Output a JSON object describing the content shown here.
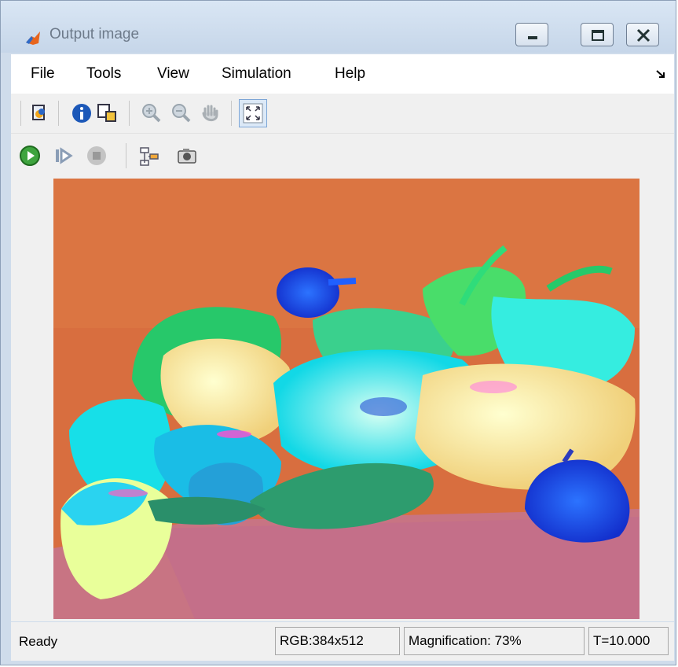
{
  "window": {
    "title": "Output image"
  },
  "menu": [
    "File",
    "Tools",
    "View",
    "Simulation",
    "Help"
  ],
  "toolbar": {
    "icons": [
      "print-icon",
      "info-icon",
      "export-icon",
      "zoom-in-icon",
      "zoom-out-icon",
      "pan-icon",
      "fit-to-window-icon"
    ],
    "sim_icons": [
      "run-icon",
      "step-forward-icon",
      "stop-icon",
      "highlight-block-icon",
      "snapshot-icon"
    ]
  },
  "image": {
    "description": "pseudo-color rendering of peppers"
  },
  "status": {
    "state": "Ready",
    "format": "RGB:384x512",
    "magnification": "Magnification: 73%",
    "time": "T=10.000"
  },
  "colors": {
    "background": "#d46c3d",
    "floor": "#c46f86",
    "accent": "#1f4ce8"
  }
}
